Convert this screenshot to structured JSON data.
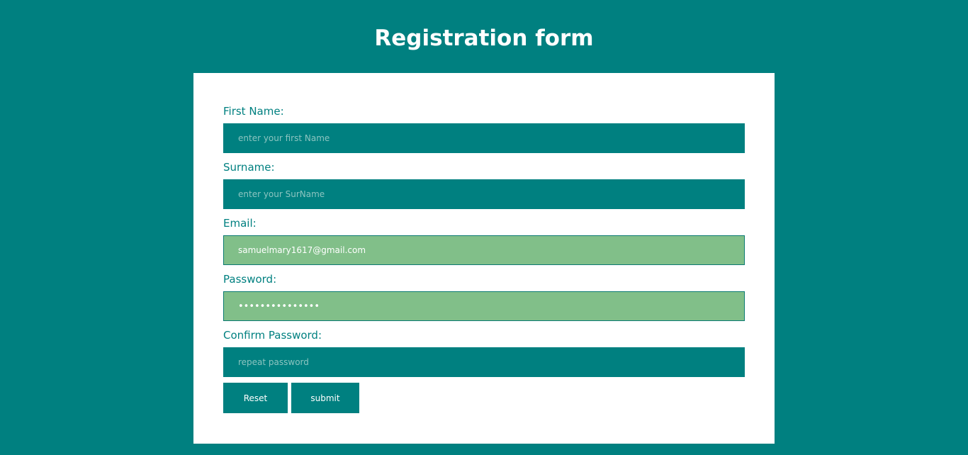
{
  "page": {
    "title": "Registration form",
    "background_color": "#008080",
    "card_color": "#ffffff",
    "accent_color": "#008080",
    "filled_field_color": "#81bf89"
  },
  "form": {
    "first_name": {
      "label": "First Name:",
      "placeholder": "enter your first Name",
      "value": ""
    },
    "surname": {
      "label": "Surname:",
      "placeholder": "enter your SurName",
      "value": ""
    },
    "email": {
      "label": "Email:",
      "placeholder": "",
      "value": "samuelmary1617@gmail.com"
    },
    "password": {
      "label": "Password:",
      "placeholder": "",
      "value": "•••••••••••••••"
    },
    "confirm_password": {
      "label": "Confirm Password:",
      "placeholder": "repeat password",
      "value": ""
    },
    "buttons": {
      "reset_label": "Reset",
      "submit_label": "submit"
    }
  }
}
